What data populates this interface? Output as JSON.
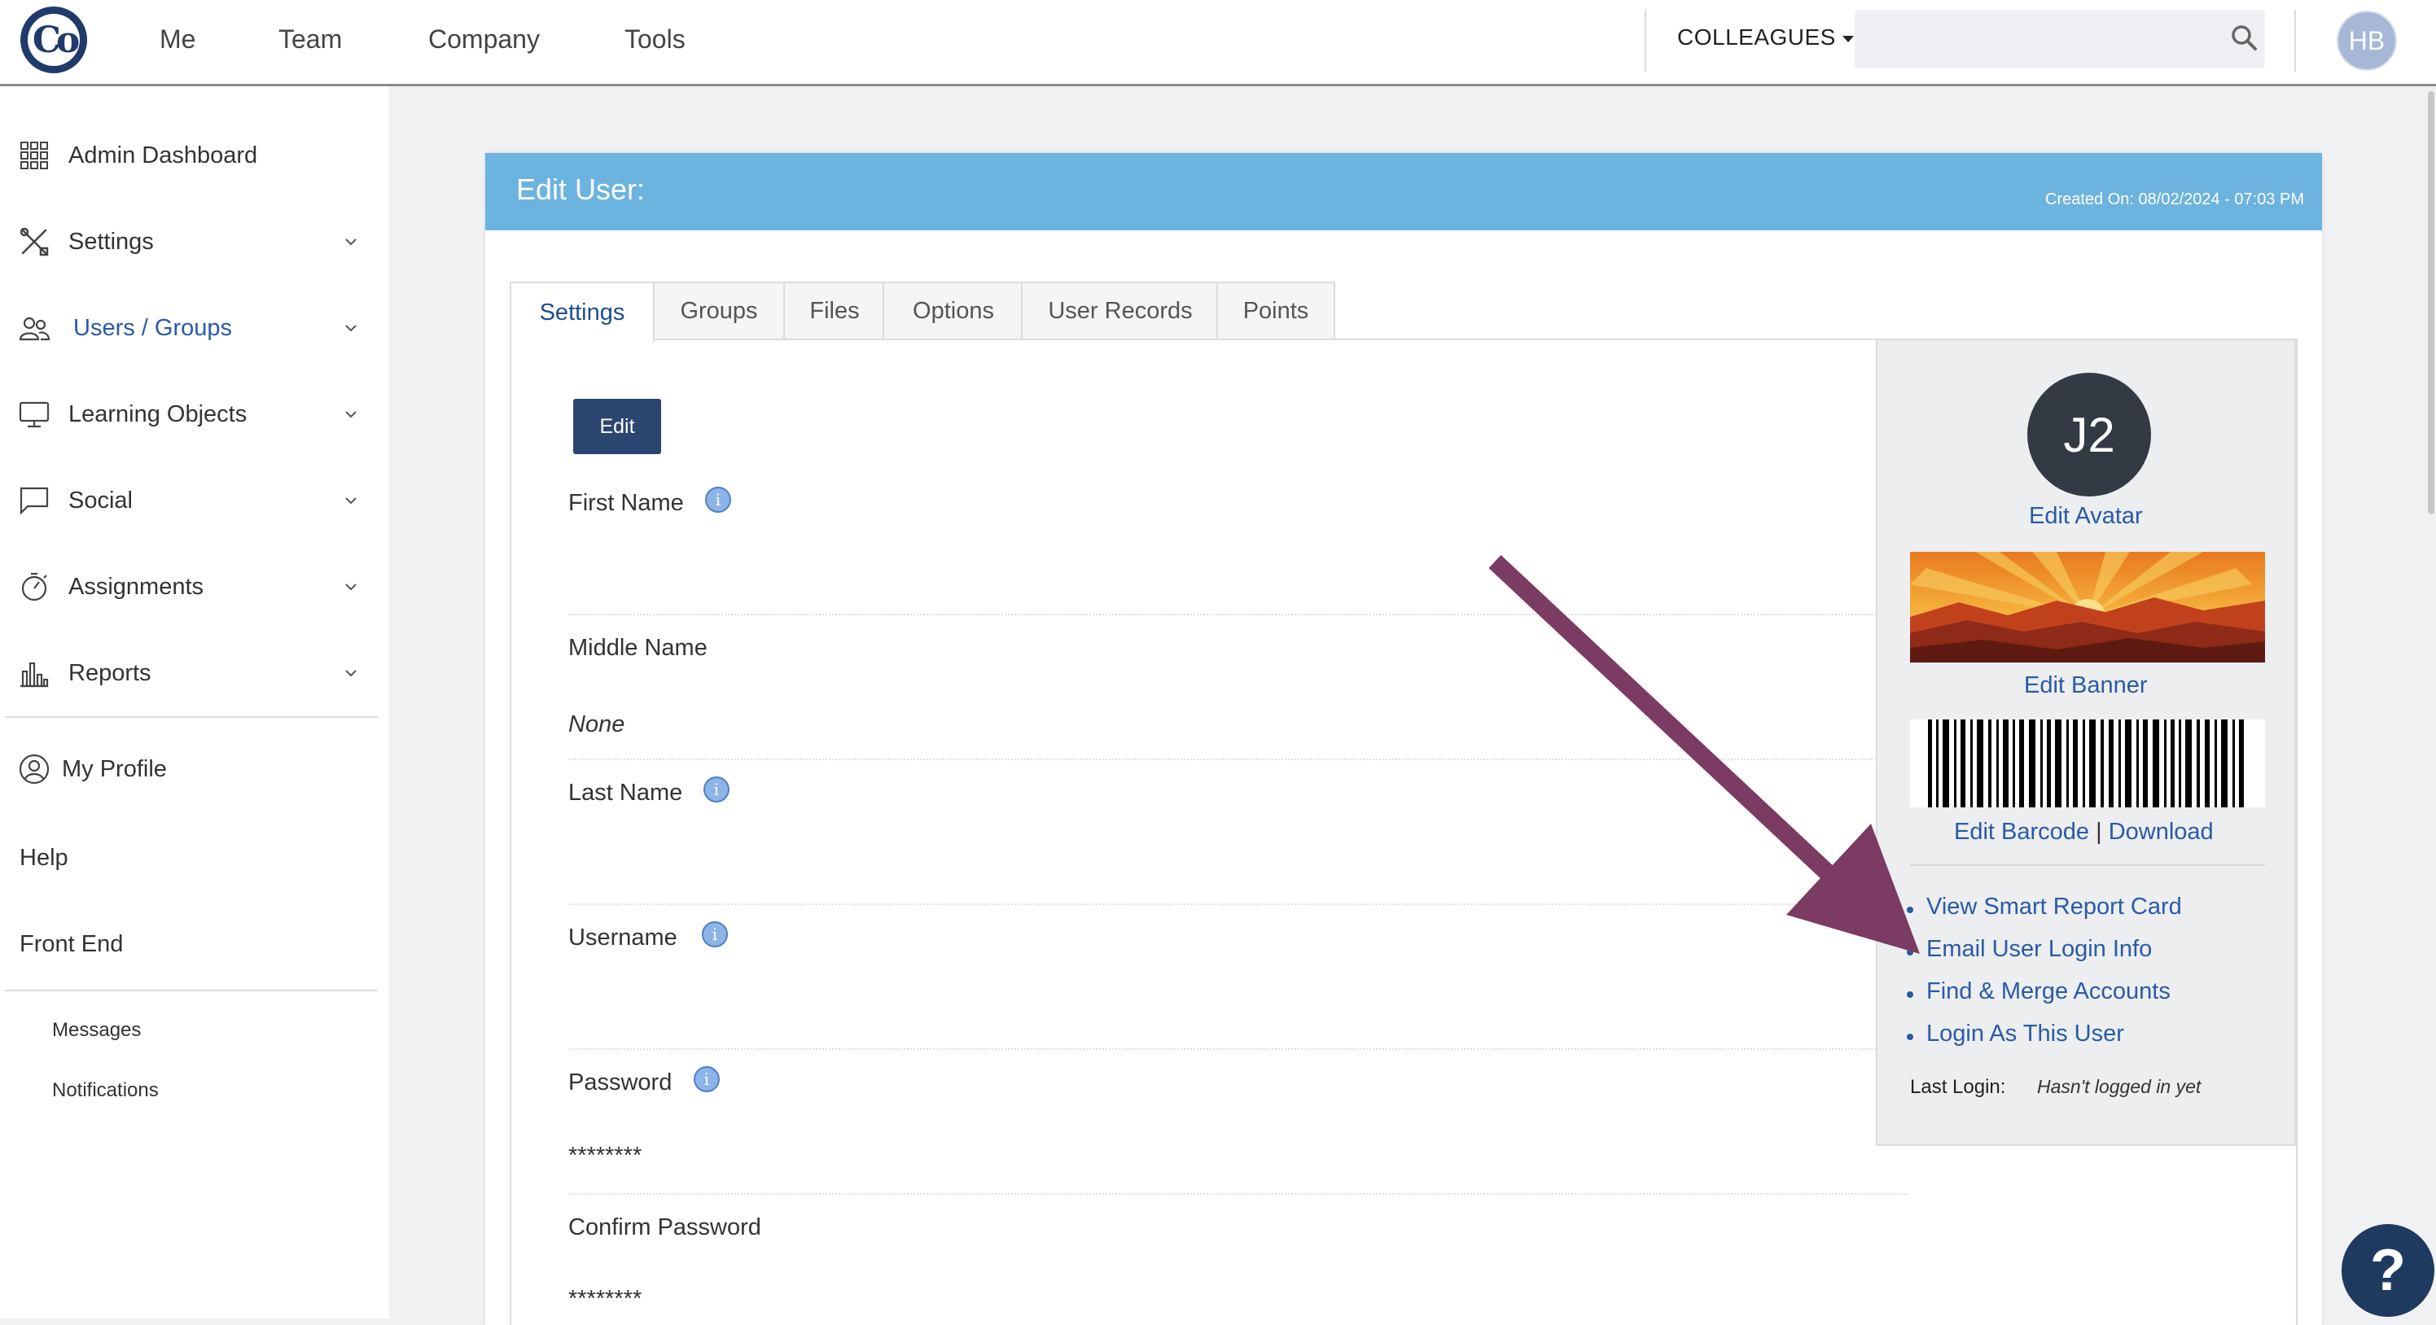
{
  "nav": {
    "items": [
      "Me",
      "Team",
      "Company",
      "Tools"
    ],
    "colleagues_label": "COLLEAGUES",
    "search_placeholder": "",
    "user_initials": "HB"
  },
  "sidebar": {
    "items": [
      {
        "label": "Admin Dashboard",
        "icon": "grid-icon"
      },
      {
        "label": "Settings",
        "icon": "tools-icon"
      },
      {
        "label": "Users / Groups",
        "icon": "users-icon"
      },
      {
        "label": "Learning Objects",
        "icon": "monitor-icon"
      },
      {
        "label": "Social",
        "icon": "chat-icon"
      },
      {
        "label": "Assignments",
        "icon": "stopwatch-icon"
      },
      {
        "label": "Reports",
        "icon": "bar-chart-icon"
      }
    ],
    "my_profile": "My Profile",
    "help": "Help",
    "front_end": "Front End",
    "messages": "Messages",
    "notifications": "Notifications"
  },
  "card": {
    "title": "Edit User:",
    "created": "Created On: 08/02/2024 - 07:03 PM",
    "tabs": [
      "Settings",
      "Groups",
      "Files",
      "Options",
      "User Records",
      "Points"
    ],
    "edit_button": "Edit",
    "fields": [
      {
        "label": "First Name",
        "value": "",
        "info": true
      },
      {
        "label": "Middle Name",
        "value": "None",
        "info": false
      },
      {
        "label": "Last Name",
        "value": "",
        "info": true
      },
      {
        "label": "Username",
        "value": "",
        "info": true
      },
      {
        "label": "Password",
        "value": "********",
        "info": true
      },
      {
        "label": "Confirm Password",
        "value": "********",
        "info": false
      }
    ]
  },
  "profile_panel": {
    "initials": "J2",
    "edit_avatar": "Edit Avatar",
    "edit_banner": "Edit Banner",
    "edit_barcode": "Edit Barcode",
    "barcode_sep": "|",
    "download": "Download",
    "actions": [
      "View Smart Report Card",
      "Email User Login Info",
      "Find & Merge Accounts",
      "Login As This User"
    ],
    "last_login_label": "Last Login:",
    "last_login_value": "Hasn't logged in yet"
  },
  "colors": {
    "header_blue": "#6cb3e0",
    "link_blue": "#2a5aa6",
    "button_navy": "#2b4571",
    "arrow_purple": "#7b3b63"
  }
}
